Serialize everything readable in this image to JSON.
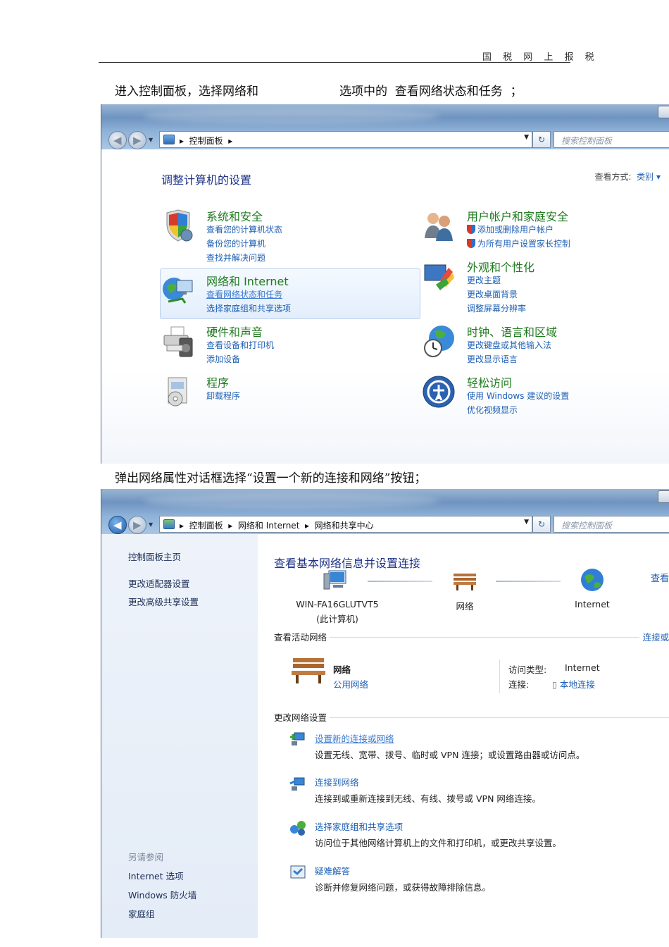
{
  "document": {
    "header": "国 税 网 上 报 税",
    "line1_part1": "进入控制面板，选择网络和",
    "line1_part2": "选项中的  查看网络状态和任务  ；",
    "line2": "弹出网络属性对话框选择“设置一个新的连接和网络”按钮；"
  },
  "window1": {
    "breadcrumb": "▸  控制面板  ▸",
    "search_placeholder": "搜索控制面板",
    "title": "调整计算机的设置",
    "view_by_label": "查看方式:",
    "view_by_value": "类别 ▾",
    "categories": [
      {
        "title": "系统和安全",
        "links": [
          "查看您的计算机状态",
          "备份您的计算机",
          "查找并解决问题"
        ],
        "icon": "shield-icon"
      },
      {
        "title": "网络和 Internet",
        "links": [
          "查看网络状态和任务",
          "选择家庭组和共享选项"
        ],
        "icon": "network-globe-icon"
      },
      {
        "title": "硬件和声音",
        "links": [
          "查看设备和打印机",
          "添加设备"
        ],
        "icon": "printer-icon"
      },
      {
        "title": "程序",
        "links": [
          "卸载程序"
        ],
        "icon": "programs-icon"
      },
      {
        "title": "用户帐户和家庭安全",
        "links": [
          "添加或删除用户帐户",
          "为所有用户设置家长控制"
        ],
        "icon": "users-icon"
      },
      {
        "title": "外观和个性化",
        "links": [
          "更改主题",
          "更改桌面背景",
          "调整屏幕分辨率"
        ],
        "icon": "appearance-icon"
      },
      {
        "title": "时钟、语言和区域",
        "links": [
          "更改键盘或其他输入法",
          "更改显示语言"
        ],
        "icon": "clock-globe-icon"
      },
      {
        "title": "轻松访问",
        "links": [
          "使用 Windows 建议的设置",
          "优化视频显示"
        ],
        "icon": "ease-of-access-icon"
      }
    ]
  },
  "window2": {
    "breadcrumb": "▸  控制面板  ▸  网络和 Internet  ▸  网络和共享中心",
    "search_placeholder": "搜索控制面板",
    "sidebar": {
      "home": "控制面板主页",
      "links": [
        "更改适配器设置",
        "更改高级共享设置"
      ],
      "see_also": "另请参阅",
      "see_also_links": [
        "Internet 选项",
        "Windows 防火墙",
        "家庭组"
      ]
    },
    "main_title": "查看基本网络信息并设置连接",
    "right_link": "查看",
    "nodes": {
      "computer": "WIN-FA16GLUTVT5",
      "computer_sub": "(此计算机)",
      "network": "网络",
      "internet": "Internet"
    },
    "active_header": "查看活动网络",
    "active_right": "连接或",
    "active_network": {
      "name": "网络",
      "type": "公用网络",
      "access_label": "访问类型:",
      "access_value": "Internet",
      "conn_label": "连接:",
      "conn_value": "本地连接"
    },
    "change_header": "更改网络设置",
    "tasks": [
      {
        "link": "设置新的连接或网络",
        "desc": "设置无线、宽带、拨号、临时或 VPN 连接；或设置路由器或访问点。"
      },
      {
        "link": "连接到网络",
        "desc": "连接到或重新连接到无线、有线、拨号或 VPN 网络连接。"
      },
      {
        "link": "选择家庭组和共享选项",
        "desc": "访问位于其他网络计算机上的文件和打印机，或更改共享设置。"
      },
      {
        "link": "疑难解答",
        "desc": "诊断并修复网络问题，或获得故障排除信息。"
      }
    ]
  }
}
